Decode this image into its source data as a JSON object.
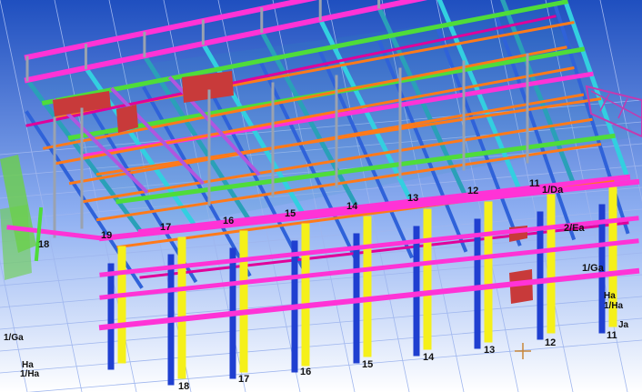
{
  "viewport": {
    "background_top": "#1f4fbf",
    "background_bottom": "#ffffff",
    "grid_line_color": "#9fb6ee"
  },
  "colors": {
    "beam_magenta": "#ff33d6",
    "beam_pink_dark": "#e0009a",
    "beam_green": "#4fdc3a",
    "beam_cyan": "#33cfe0",
    "beam_teal": "#2aa0b8",
    "beam_orange": "#ff7a1a",
    "beam_purple": "#b056e0",
    "beam_blue": "#2f62d9",
    "column_yellow": "#f5f01a",
    "column_blue": "#1f3fd0",
    "column_gray": "#9aa2b0",
    "wall_red": "#c83a3a",
    "stair_green": "#6bd04a",
    "cursor_color": "#c8873a"
  },
  "grid_labels_back": [
    "19",
    "18",
    "17",
    "16",
    "15",
    "14",
    "13",
    "12",
    "11",
    "1/Da",
    "2/Ea",
    "1/Ga"
  ],
  "grid_labels_front": [
    "18",
    "17",
    "16",
    "15",
    "14",
    "13",
    "12",
    "11"
  ],
  "grid_labels_right": [
    "Ha",
    "1/Ha",
    "Ja"
  ],
  "grid_labels_left": [
    "19",
    "1/Ga",
    "Ha",
    "1/Ha"
  ]
}
